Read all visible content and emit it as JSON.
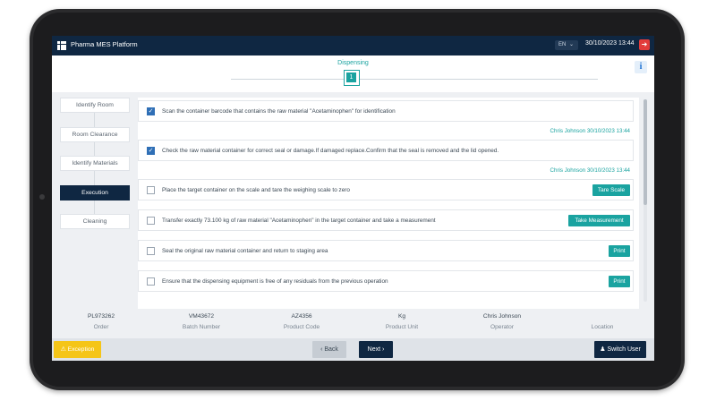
{
  "header": {
    "app_title": "Pharma MES Platform",
    "language": "EN",
    "datetime": "30/10/2023 13:44",
    "grid_icon": "grid-menu-icon",
    "logout_icon": "logout-icon"
  },
  "stepper": {
    "stage_label": "Dispensing",
    "stage_number": "1",
    "info_label": "i"
  },
  "sidebar": {
    "items": [
      {
        "label": "Identify Room"
      },
      {
        "label": "Room Clearance"
      },
      {
        "label": "Identify Materials"
      },
      {
        "label": "Execution"
      },
      {
        "label": "Cleaning"
      }
    ],
    "active": "Execution"
  },
  "tasks": [
    {
      "text": "Scan the container barcode that contains the raw material \"Acetaminophen\" for identification",
      "checked": true,
      "signoff": "Chris Johnson 30/10/2023 13:44",
      "button": ""
    },
    {
      "text": "Check the raw material container for correct seal or damage.If damaged replace.Confirm that the seal is removed and the lid opened.",
      "checked": true,
      "signoff": "Chris Johnson 30/10/2023 13:44",
      "button": ""
    },
    {
      "text": "Place the target container on the scale and tare the weighing scale to zero",
      "checked": false,
      "signoff": "",
      "button": "Tare Scale"
    },
    {
      "text": "Transfer exactly 73.100 kg of raw material \"Acetaminophen\" in the target container and take a measurement",
      "checked": false,
      "signoff": "",
      "button": "Take Measurement"
    },
    {
      "text": "Seal the original raw material container and return to staging area",
      "checked": false,
      "signoff": "",
      "button": "Print"
    },
    {
      "text": "Ensure that the dispensing equipment is free of any residuals from the previous operation",
      "checked": false,
      "signoff": "",
      "button": "Print"
    }
  ],
  "info": [
    {
      "value": "PL973262",
      "label": "Order"
    },
    {
      "value": "VM43672",
      "label": "Batch Number"
    },
    {
      "value": "AZ4356",
      "label": "Product Code"
    },
    {
      "value": "Kg",
      "label": "Product Unit"
    },
    {
      "value": "Chris Johnson",
      "label": "Operator"
    },
    {
      "value": "",
      "label": "Location"
    }
  ],
  "footer": {
    "exception": "Exception",
    "back": "Back",
    "next": "Next",
    "switch_user": "Switch User"
  },
  "colors": {
    "navy": "#0f2742",
    "teal": "#1aa3a0",
    "exception_yellow": "#f5c518",
    "checkbox_blue": "#2f6fb6",
    "logout_red": "#e23b3b"
  }
}
